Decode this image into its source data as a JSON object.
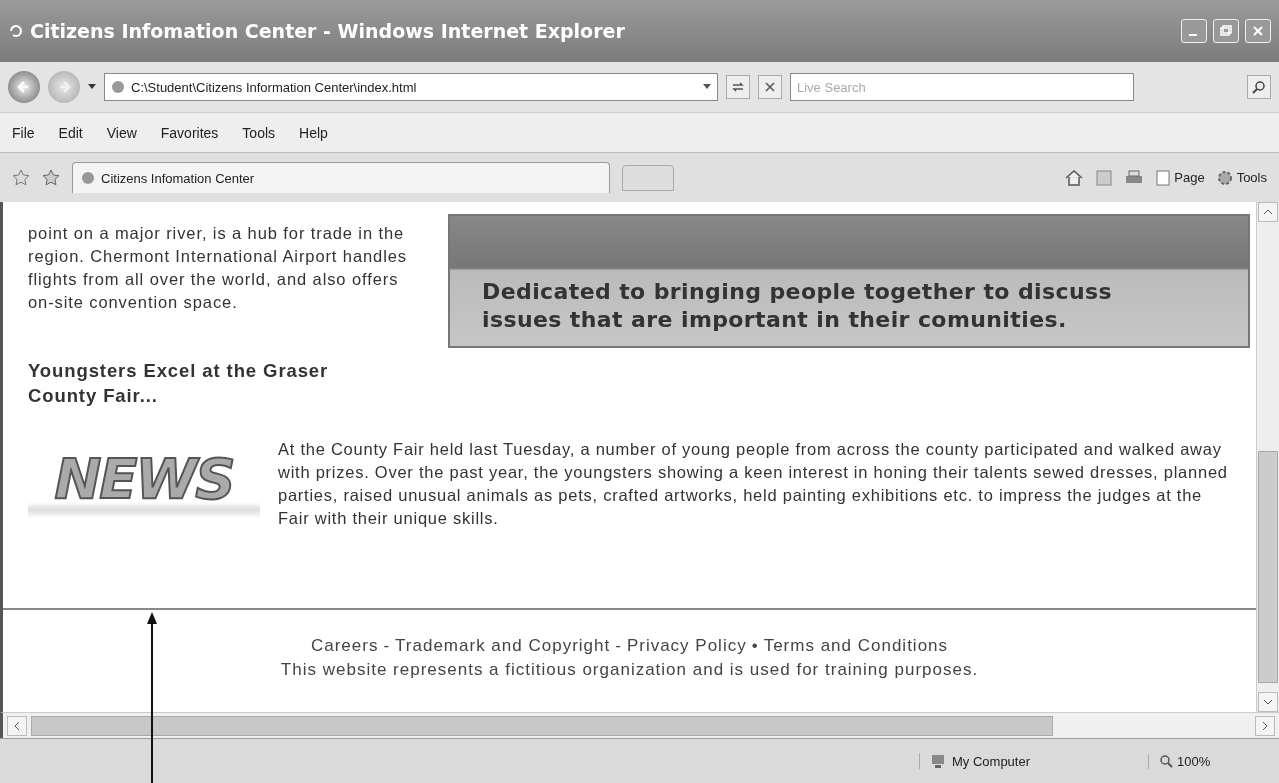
{
  "window": {
    "title": "Citizens Infomation Center - Windows Internet Explorer"
  },
  "address_bar": {
    "address": "C:\\Student\\Citizens Information Center\\index.html",
    "search_placeholder": "Live Search"
  },
  "menu": [
    "File",
    "Edit",
    "View",
    "Favorites",
    "Tools",
    "Help"
  ],
  "tabs": [
    {
      "title": "Citizens Infomation Center",
      "selected": true
    }
  ],
  "command_bar": {
    "page": "Page",
    "tools": "Tools"
  },
  "content": {
    "intro": "point on a major river, is a hub for trade in the region. Chermont International Airport handles flights from all over the world, and also offers on-site convention space.",
    "banner": "Dedicated to bringing people together to discuss issues that are important in their comunities.",
    "article_heading": "Youngsters Excel at the Graser County Fair...",
    "logo_text": "NEWS",
    "article_body": "At the County Fair held last Tuesday, a number of young people from across the county participated and walked away with prizes. Over the past year, the youngsters showing a keen interest in honing their talents sewed dresses, planned parties, raised unusual animals as pets, crafted artworks, held painting exhibitions etc. to impress the judges at the Fair with their unique skills."
  },
  "footer": {
    "links": [
      "Careers",
      "Trademark and Copyright",
      "Privacy Policy",
      "Terms and Conditions"
    ],
    "separators": [
      "-",
      "-",
      "•"
    ],
    "note": "This website represents a fictitious organization and is used for training purposes."
  },
  "status_bar": {
    "zone": "My Computer",
    "zoom": "100%"
  }
}
